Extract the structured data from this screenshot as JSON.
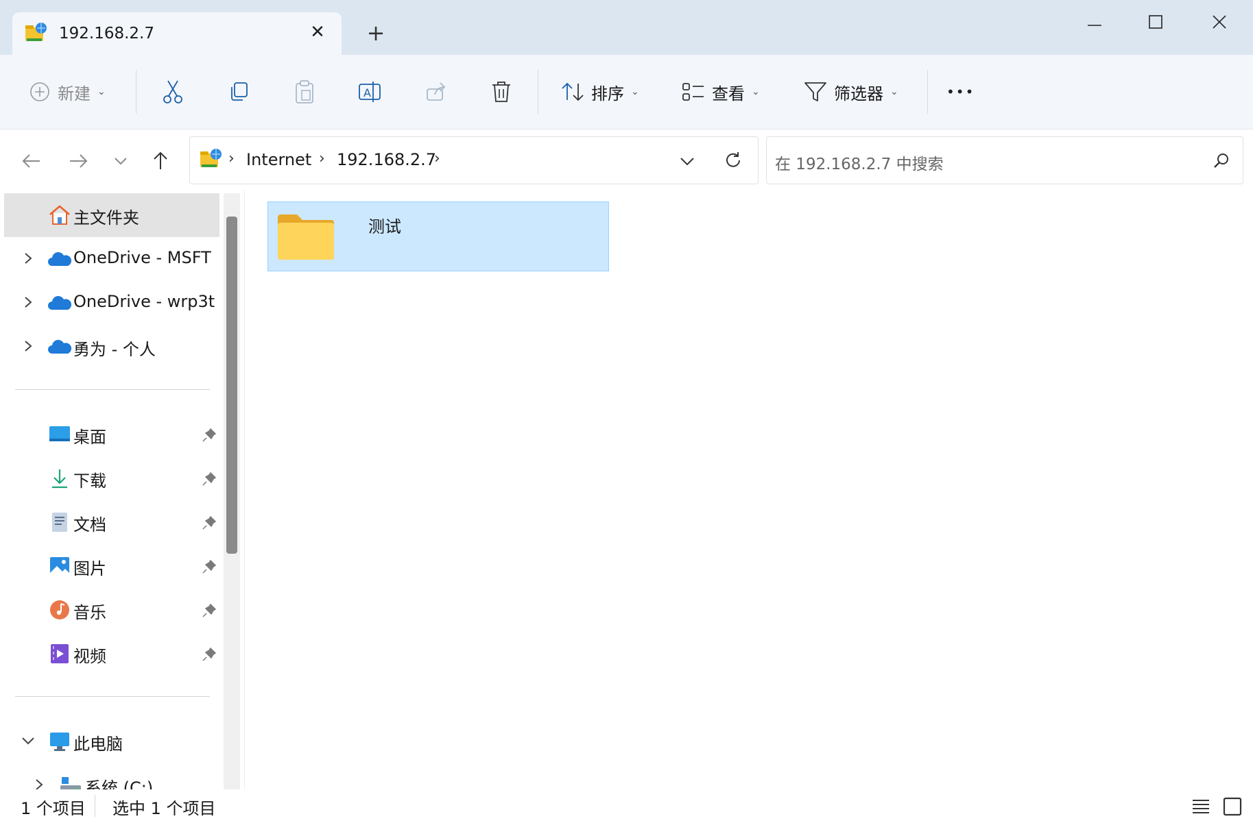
{
  "tab": {
    "title": "192.168.2.7",
    "close_glyph": "✕",
    "new_tab_glyph": "+"
  },
  "toolbar": {
    "new_label": "新建",
    "sort_label": "排序",
    "view_label": "查看",
    "filter_label": "筛选器",
    "more_glyph": "•••",
    "caret_glyph": "⌄"
  },
  "address": {
    "crumbs": [
      "Internet",
      "192.168.2.7"
    ],
    "sep_glyph": "›",
    "search_placeholder": "在 192.168.2.7 中搜索"
  },
  "sidebar": {
    "top_items": [
      {
        "label": "主文件夹",
        "icon": "home-icon"
      },
      {
        "label": "OneDrive - MSFT",
        "icon": "onedrive-icon"
      },
      {
        "label": "OneDrive - wrp3t",
        "icon": "onedrive-icon"
      },
      {
        "label": "勇为 - 个人",
        "icon": "onedrive-icon"
      }
    ],
    "pinned_items": [
      {
        "label": "桌面",
        "icon": "desktop-icon"
      },
      {
        "label": "下载",
        "icon": "download-icon"
      },
      {
        "label": "文档",
        "icon": "documents-icon"
      },
      {
        "label": "图片",
        "icon": "pictures-icon"
      },
      {
        "label": "音乐",
        "icon": "music-icon"
      },
      {
        "label": "视频",
        "icon": "videos-icon"
      }
    ],
    "pc_items": [
      {
        "label": "此电脑",
        "icon": "this-pc-icon"
      },
      {
        "label": "系统 (C:)",
        "icon": "drive-icon"
      }
    ]
  },
  "content": {
    "items": [
      {
        "name": "测试",
        "type": "folder",
        "selected": true
      }
    ]
  },
  "status": {
    "item_count": "1 个项目",
    "selected_count": "选中 1 个项目"
  },
  "colors": {
    "titlebar": "#dce6f1",
    "toolbar": "#f3f6fb",
    "selection": "#cce8ff",
    "selection_border": "#99d1ff",
    "folder": "#ffd04a",
    "accent": "#0067c0"
  }
}
